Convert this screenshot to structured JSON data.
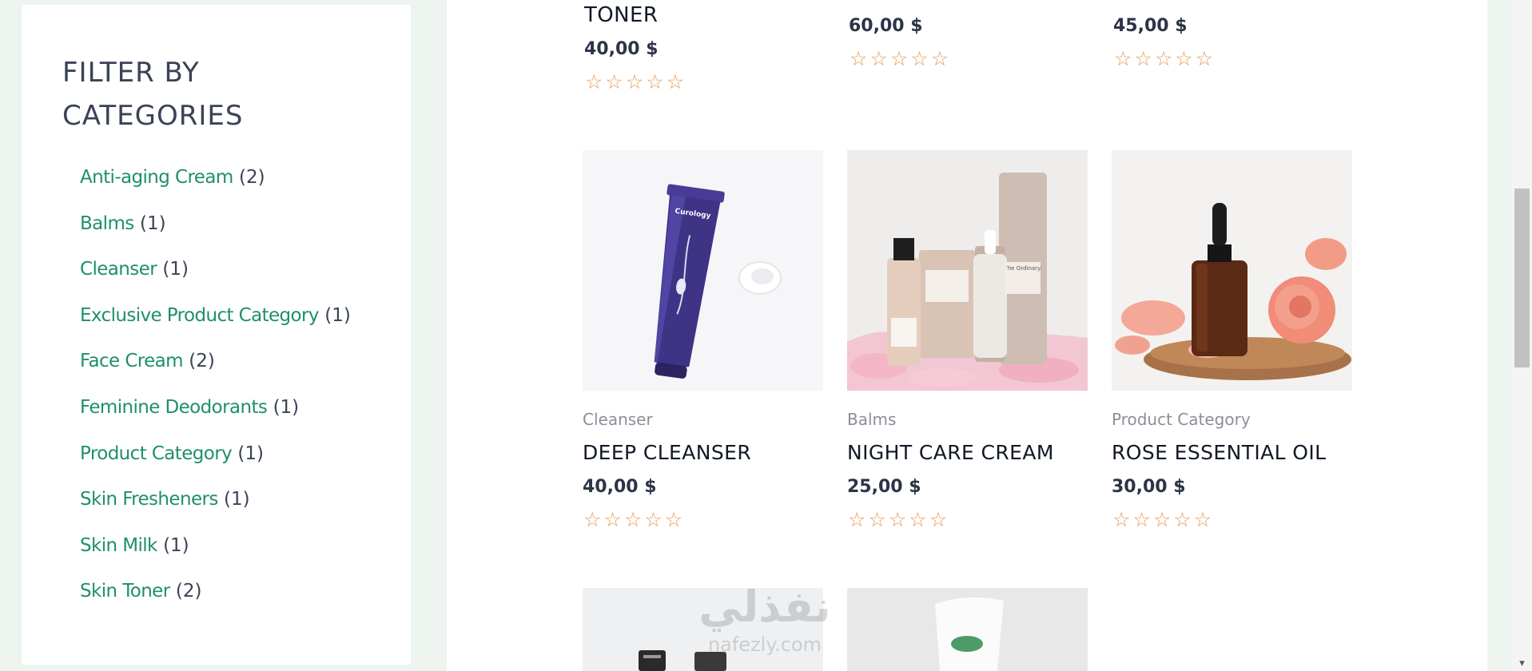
{
  "sidebar": {
    "title": "FILTER BY CATEGORIES",
    "categories": [
      {
        "name": "Anti-aging Cream",
        "count": "(2)"
      },
      {
        "name": "Balms",
        "count": "(1)"
      },
      {
        "name": "Cleanser",
        "count": "(1)"
      },
      {
        "name": "Exclusive Product Category",
        "count": "(1)"
      },
      {
        "name": "Face Cream",
        "count": "(2)"
      },
      {
        "name": "Feminine Deodorants",
        "count": "(1)"
      },
      {
        "name": "Product Category",
        "count": "(1)"
      },
      {
        "name": "Skin Fresheners",
        "count": "(1)"
      },
      {
        "name": "Skin Milk",
        "count": "(1)"
      },
      {
        "name": "Skin Toner",
        "count": "(2)"
      }
    ]
  },
  "products_top": [
    {
      "title": "TONER",
      "price": "40,00 $",
      "rating": 0
    },
    {
      "price": "60,00 $",
      "rating": 0
    },
    {
      "price": "45,00 $",
      "rating": 0
    }
  ],
  "products": [
    {
      "category": "Cleanser",
      "title": "DEEP CLEANSER",
      "price": "40,00 $",
      "rating": 0
    },
    {
      "category": "Balms",
      "title": "NIGHT CARE CREAM",
      "price": "25,00 $",
      "rating": 0
    },
    {
      "category": "Product Category",
      "title": "ROSE ESSENTIAL OIL",
      "price": "30,00 $",
      "rating": 0
    }
  ],
  "images": {
    "tube_brand": "Curology",
    "bottle_brand": "The Ordinary."
  },
  "watermark": {
    "text": "نفذلي",
    "sub": "nafezly.com"
  },
  "colors": {
    "accent": "#1f8f6e",
    "star": "#e69a56",
    "heading": "#3a4256"
  },
  "icons": {
    "star": "star-outline-icon",
    "scroll_down": "chevron-down-icon"
  }
}
